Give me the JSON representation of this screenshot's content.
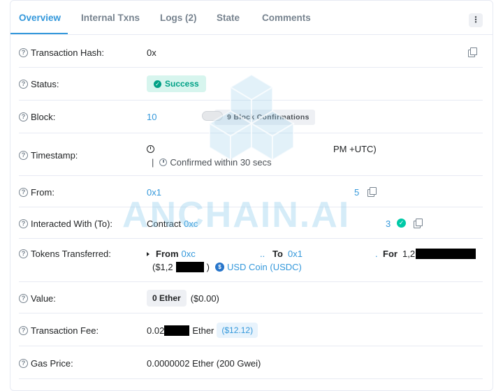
{
  "tabs": [
    {
      "label": "Overview"
    },
    {
      "label": "Internal Txns"
    },
    {
      "label": "Logs (2)"
    },
    {
      "label": "State"
    },
    {
      "label": "Comments"
    }
  ],
  "more_label": "⋮",
  "rows": {
    "tx_hash": {
      "label": "Transaction Hash:",
      "value": "0x"
    },
    "status": {
      "label": "Status:",
      "value": "Success"
    },
    "block": {
      "label": "Block:",
      "value": "10",
      "confirmations": "9 Block Confirmations"
    },
    "timestamp": {
      "label": "Timestamp:",
      "value_suffix": "PM +UTC)",
      "confirmed": "Confirmed within 30 secs",
      "separator": "|"
    },
    "from": {
      "label": "From:",
      "value_start": "0x1",
      "value_end": "5"
    },
    "to": {
      "label": "Interacted With (To):",
      "prefix": "Contract",
      "value_start": "0xc",
      "value_end": "3"
    },
    "tokens": {
      "label": "Tokens Transferred:",
      "from_label": "From",
      "from_value": "0xc",
      "to_label": "To",
      "to_value": "0x1",
      "for_label": "For",
      "amount_prefix": "1,2",
      "usd_prefix": "($1,2",
      "usd_suffix": ")",
      "token_name": "USD Coin (USDC)",
      "dots": "..",
      "dot": "."
    },
    "value": {
      "label": "Value:",
      "amount": "0 Ether",
      "usd": "($0.00)"
    },
    "fee": {
      "label": "Transaction Fee:",
      "prefix": "0.02",
      "unit": "Ether",
      "usd": "($12.12)"
    },
    "gas_price": {
      "label": "Gas Price:",
      "value": "0.0000002 Ether (200 Gwei)"
    }
  },
  "watermark": "ANCHAIN.AI",
  "help_glyph": "?",
  "colors": {
    "accent": "#3498db",
    "success": "#00a186",
    "border": "#e7eaf3"
  }
}
